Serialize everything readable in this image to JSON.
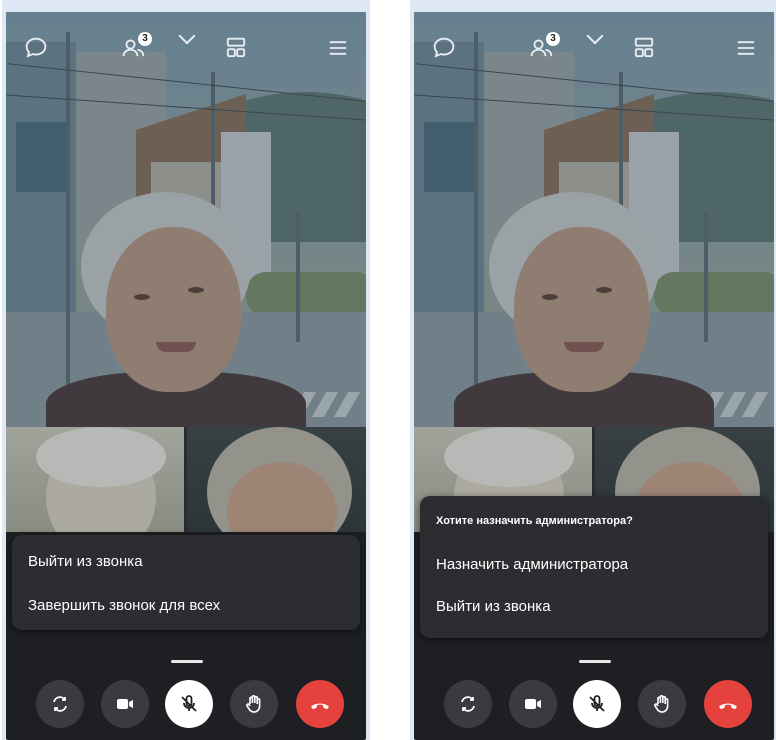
{
  "left_screen": {
    "participants_badge": "3",
    "menu": {
      "items": [
        "Выйти из звонка",
        "Завершить звонок для всех"
      ]
    }
  },
  "right_screen": {
    "participants_badge": "3",
    "menu": {
      "title": "Хотите назначить администратора?",
      "items": [
        "Назначить администратора",
        "Выйти из звонка"
      ]
    }
  },
  "toolbar_icons": [
    "chat-icon",
    "participants-icon",
    "layout-icon",
    "menu-icon"
  ],
  "controls": [
    "switch-camera-icon",
    "camera-icon",
    "mic-muted-icon",
    "raise-hand-icon",
    "hang-up-icon"
  ],
  "colors": {
    "hangup": "#e5413d",
    "menu_bg": "#2c2d31",
    "screen_bg": "#1e1f22"
  }
}
